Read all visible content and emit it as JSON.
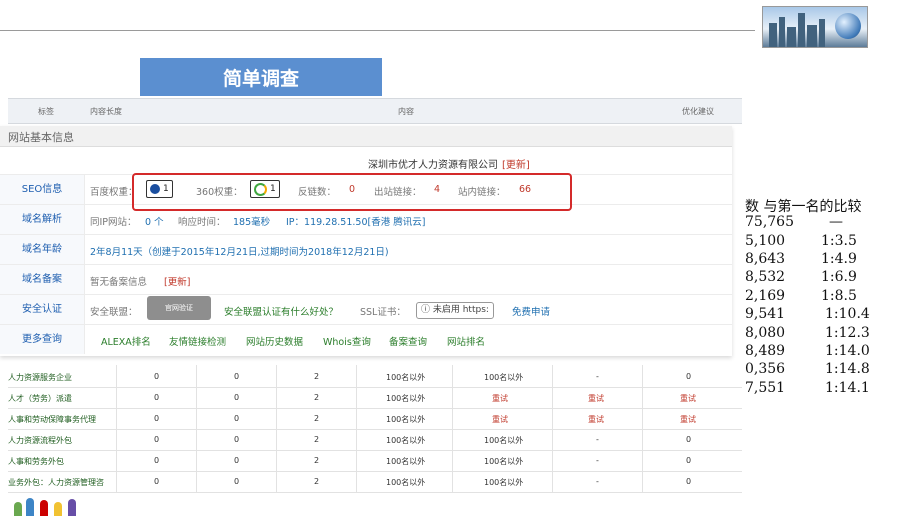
{
  "slide": {
    "title": "简单调查"
  },
  "compare": {
    "header": "数 与第一名的比较",
    "rows": [
      {
        "num": "75,765",
        "ratio": "—"
      },
      {
        "num": "5,100",
        "ratio": "1:3.5"
      },
      {
        "num": "8,643",
        "ratio": "1:4.9"
      },
      {
        "num": "8,532",
        "ratio": "1:6.9"
      },
      {
        "num": "2,169",
        "ratio": "1:8.5"
      },
      {
        "num": "9,541",
        "ratio": "1:10.4"
      },
      {
        "num": "8,080",
        "ratio": "1:12.3"
      },
      {
        "num": "8,489",
        "ratio": "1:14.0"
      },
      {
        "num": "0,356",
        "ratio": "1:14.8"
      },
      {
        "num": "7,551",
        "ratio": "1:14.1"
      }
    ]
  },
  "bg_table": {
    "headers": [
      "标签",
      "内容长度",
      "内容",
      "优化建议"
    ],
    "rows": [
      {
        "label": "人力资源服务企业",
        "c1": "0",
        "c2": "0",
        "c3": "2",
        "c4": "100名以外",
        "c5": "100名以外",
        "c6": "-",
        "c7": "0"
      },
      {
        "label": "人才（劳务）派遣",
        "c1": "0",
        "c2": "0",
        "c3": "2",
        "c4": "100名以外",
        "c5": "重试",
        "c6": "重试",
        "c7": "重试"
      },
      {
        "label": "人事和劳动保障事务代理",
        "c1": "0",
        "c2": "0",
        "c3": "2",
        "c4": "100名以外",
        "c5": "重试",
        "c6": "重试",
        "c7": "重试"
      },
      {
        "label": "人力资源流程外包",
        "c1": "0",
        "c2": "0",
        "c3": "2",
        "c4": "100名以外",
        "c5": "100名以外",
        "c6": "-",
        "c7": "0"
      },
      {
        "label": "人事和劳务外包",
        "c1": "0",
        "c2": "0",
        "c3": "2",
        "c4": "100名以外",
        "c5": "100名以外",
        "c6": "-",
        "c7": "0"
      },
      {
        "label": "业务外包：人力资源管理咨",
        "c1": "0",
        "c2": "0",
        "c3": "2",
        "c4": "100名以外",
        "c5": "100名以外",
        "c6": "-",
        "c7": "0"
      }
    ]
  },
  "card": {
    "heading": "网站基本信息",
    "company": "深圳市优才人力资源有限公司",
    "update_link": "[更新]",
    "seo": {
      "label": "SEO信息",
      "baidu_label": "百度权重：",
      "baidu_value": "1",
      "r360_label": "360权重：",
      "r360_value": "1",
      "backlinks_label": "反链数：",
      "backlinks_value": "0",
      "outlinks_label": "出站链接：",
      "outlinks_value": "4",
      "inlinks_label": "站内链接：",
      "inlinks_value": "66"
    },
    "domain": {
      "label": "域名解析",
      "sameip_label": "同IP网站：",
      "sameip_value": "0 个",
      "resp_label": "响应时间：",
      "resp_value": "185毫秒",
      "ip_text": "IP：119.28.51.50[香港 腾讯云]"
    },
    "age": {
      "label": "域名年龄",
      "text": "2年8月11天（创建于2015年12月21日,过期时间为2018年12月21日)"
    },
    "icp": {
      "label": "域名备案",
      "text": "暂无备案信息",
      "update": "[更新]"
    },
    "security": {
      "label": "安全认证",
      "alliance_label": "安全联盟：",
      "seal_text": "官网验证",
      "alliance_link": "安全联盟认证有什么好处？",
      "ssl_label": "SSL证书：",
      "ssl_button": "ⓘ 未启用 https:",
      "ssl_apply": "免费申请"
    },
    "more": {
      "label": "更多查询",
      "links": [
        "ALEXA排名",
        "友情链接检测",
        "网站历史数据",
        "Whois查询",
        "备案查询",
        "网站排名"
      ]
    }
  },
  "colors": {
    "accent": "#5b8fd0",
    "highlight": "#d42a2a",
    "link": "#1f6fb0"
  }
}
